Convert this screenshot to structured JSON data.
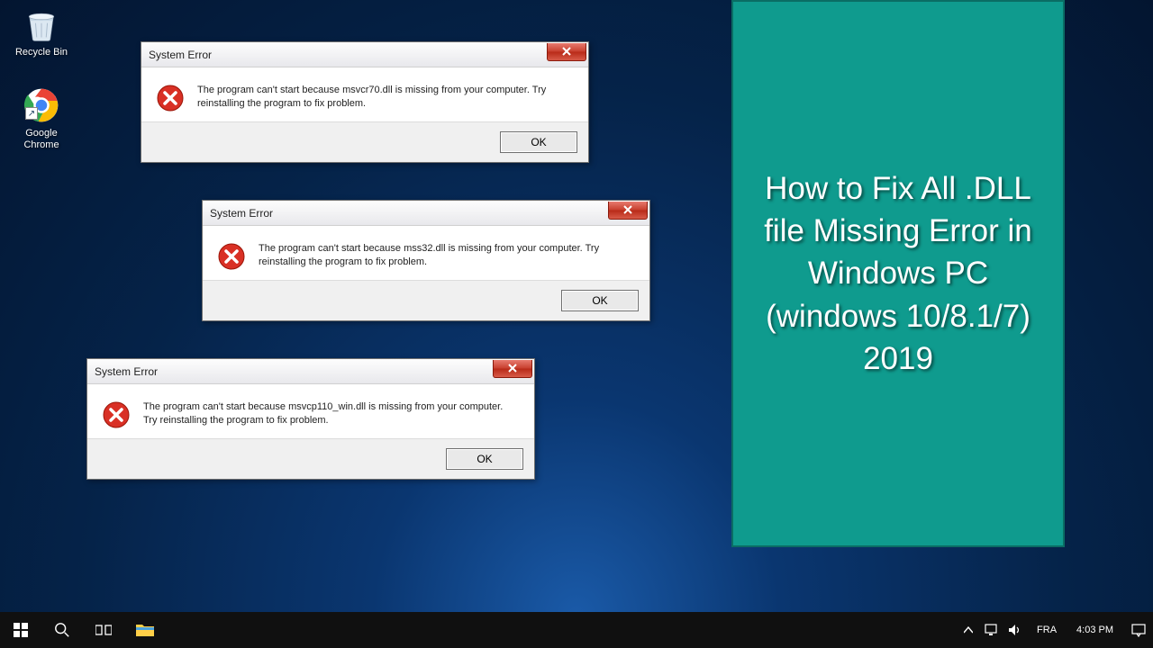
{
  "desktop": {
    "recycle_bin_label": "Recycle Bin",
    "chrome_label": "Google Chrome"
  },
  "dialogs": [
    {
      "title": "System Error",
      "message": "The program can't start because msvcr70.dll is missing from your computer. Try reinstalling the program to fix problem.",
      "ok": "OK"
    },
    {
      "title": "System Error",
      "message": "The program can't start because mss32.dll is missing from your computer. Try reinstalling the program to fix problem.",
      "ok": "OK"
    },
    {
      "title": "System Error",
      "message": "The program can't start because msvcp110_win.dll is missing from your computer. Try reinstalling the program to fix problem.",
      "ok": "OK"
    }
  ],
  "right_panel": {
    "text": "How to Fix All .DLL file Missing Error in Windows PC (windows 10/8.1/7) 2019"
  },
  "taskbar": {
    "lang": "FRA",
    "time": "4:03 PM"
  }
}
